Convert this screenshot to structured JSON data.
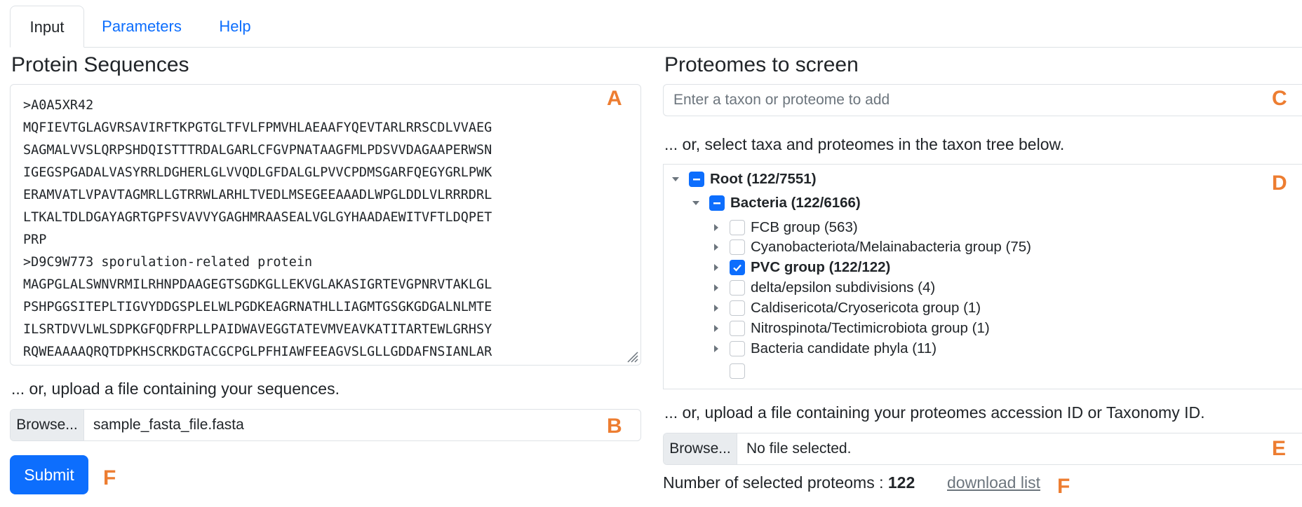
{
  "tabs": [
    {
      "label": "Input",
      "active": true
    },
    {
      "label": "Parameters",
      "active": false
    },
    {
      "label": "Help",
      "active": false
    }
  ],
  "left": {
    "heading": "Protein Sequences",
    "sequences": ">A0A5XR42\nMQFIEVTGLAGVRSAVIRFTKPGTGLTFVLFPMVHLAEAAFYQEVTARLRRSCDLVVAEG\nSAGMALVVSLQRPSHDQISTTTRDALGARLCFGVPNATAAGFMLPDSVVDAGAAPERWSN\nIGEGSPGADALVASYRRLDGHERLGLVVQDLGFDALGLPVVCPDMSGARFQEGYGRLPWK\nERAMVATLVPAVTAGMRLLGTRRWLARHLTVEDLMSEGEEAAADLWPGLDDLVLRRRDRL\nLTKALTDLDGAYAGRTGPFSVAVVYGAGHMRAASEALVGLGYHAADAEWITVFTLDQPET\nPRP\n>D9C9W773 sporulation-related protein\nMAGPGLALSWNVRMILRHNPDAAGEGTSGDKGLLEKVGLAKASIGRTEVGPNRVTAKLGL\nPSHPGGSITEPLTIGVYDDGSPLELWLPGDKEAGRNATHLLIAGMTGSGKGDGALNLMTE\nILSRTDVVLWLSDPKGFQDFRPLLPAIDWAVEGGTATEVMVEAVKATITARTEWLGRHSY\nRQWEAAAAQRQTDPKHSCRKDGTACGCPGLPFHIAWFEEAGVSLGLLGDDAFNSIANLAR",
    "upload_text": "... or, upload a file containing your sequences.",
    "browse_label": "Browse...",
    "file_name": "sample_fasta_file.fasta",
    "submit_label": "Submit"
  },
  "right": {
    "heading": "Proteomes to screen",
    "search_placeholder": "Enter a taxon or proteome to add",
    "tree_hint": "... or, select taxa and proteomes in the taxon tree below.",
    "tree": [
      {
        "label": "Root (122/7551)",
        "level": 0,
        "state": "partial",
        "expanded": true,
        "bold": true
      },
      {
        "label": "Bacteria (122/6166)",
        "level": 1,
        "state": "partial",
        "expanded": true,
        "bold": true
      },
      {
        "label": "FCB group (563)",
        "level": 2,
        "state": "unchecked",
        "expanded": false,
        "bold": false
      },
      {
        "label": "Cyanobacteriota/Melainabacteria group (75)",
        "level": 2,
        "state": "unchecked",
        "expanded": false,
        "bold": false
      },
      {
        "label": "PVC group (122/122)",
        "level": 2,
        "state": "checked",
        "expanded": false,
        "bold": true
      },
      {
        "label": "delta/epsilon subdivisions (4)",
        "level": 2,
        "state": "unchecked",
        "expanded": false,
        "bold": false
      },
      {
        "label": "Caldisericota/Cryosericota group (1)",
        "level": 2,
        "state": "unchecked",
        "expanded": false,
        "bold": false
      },
      {
        "label": "Nitrospinota/Tectimicrobiota group (1)",
        "level": 2,
        "state": "unchecked",
        "expanded": false,
        "bold": false
      },
      {
        "label": "Bacteria candidate phyla (11)",
        "level": 2,
        "state": "unchecked",
        "expanded": false,
        "bold": false
      }
    ],
    "upload_text": "... or, upload a file containing your proteomes accession ID or Taxonomy ID.",
    "browse_label": "Browse...",
    "file_name": "No file selected.",
    "count_label": "Number of selected proteoms : ",
    "count_value": "122",
    "download_label": "download list"
  },
  "markers": {
    "a": "A",
    "b": "B",
    "c": "C",
    "d": "D",
    "e": "E",
    "f1": "F",
    "f2": "F"
  },
  "colors": {
    "accent": "#0d6efd",
    "marker": "#ed7d31",
    "border": "#dee2e6"
  }
}
